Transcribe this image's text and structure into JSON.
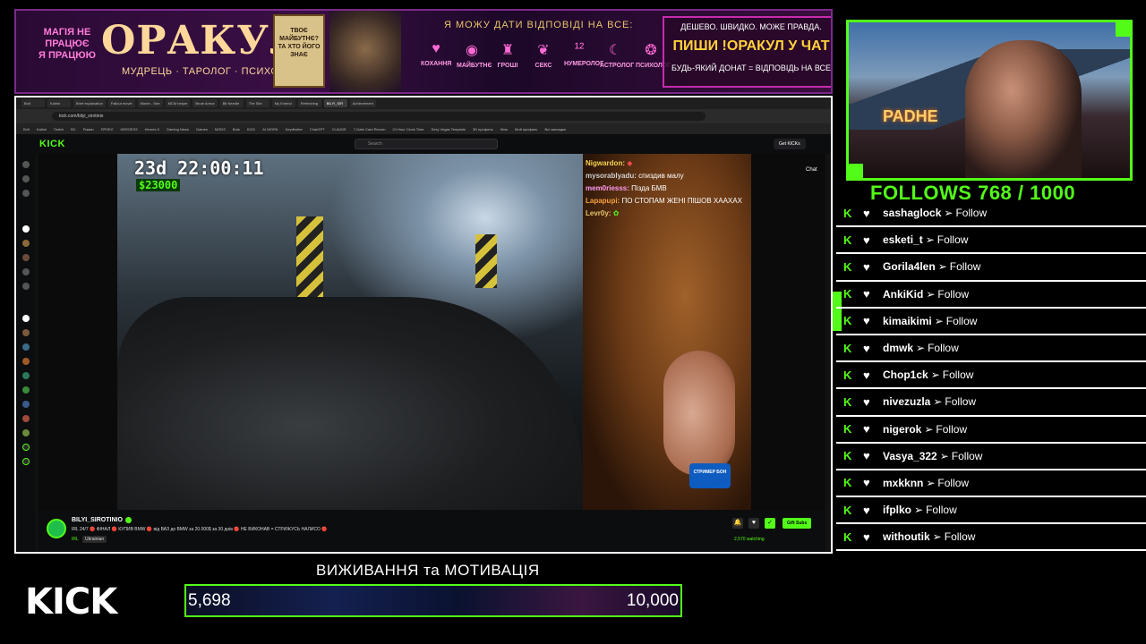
{
  "banner": {
    "magic_line1": "МАГІЯ НЕ",
    "magic_line2": "ПРАЦЮЄ",
    "magic_line3": "Я ПРАЦЮЮ",
    "title": "ОРАКУЛ",
    "subtitle": "МУДРЕЦЬ · ТАРОЛОГ · ПСИХОЛОГ",
    "card_text": "ТВОЄ МАЙБУТНЄ? ТА ХТО ЙОГО ЗНАЄ",
    "can_answer": "Я МОЖУ ДАТИ ВІДПОВІДІ НА ВСЕ:",
    "categories": [
      {
        "label": "КОХАННЯ",
        "icon": "heart-icon"
      },
      {
        "label": "МАЙБУТНЄ",
        "icon": "crystal-ball-icon"
      },
      {
        "label": "ГРОШІ",
        "icon": "money-icon"
      },
      {
        "label": "СЕКС",
        "icon": "peach-icon"
      },
      {
        "label": "НУМЕРОЛОГ",
        "icon": "numbers-icon"
      },
      {
        "label": "АСТРОЛОГ",
        "icon": "moon-icon"
      },
      {
        "label": "ПСИХОЛОГ",
        "icon": "brain-icon"
      }
    ],
    "promo_line1": "ДЕШЕВО. ШВИДКО. МОЖЕ ПРАВДА.",
    "promo_line2": "ПИШИ !ОРАКУЛ У ЧАТ",
    "promo_line3": "БУДЬ-ЯКИЙ ДОНАТ = ВІДПОВІДЬ НА ВСЕ"
  },
  "browser": {
    "tabs": [
      "Bolt",
      "Kalimi",
      "Brief explanation",
      "Fallout movie",
      "Monte - Stre",
      "MCM helper",
      "Brute Armor",
      "Bit Needle",
      "The Site",
      "My Extend",
      "Refreshing",
      "BILYI_SIR",
      "Achievement"
    ],
    "url": "kick.com/bilyi_sirotinio",
    "bookmarks": [
      "Bolt",
      "Kalimi",
      "Twitch",
      "BC",
      "Роман",
      "ПРОЕЛ",
      "HEROES3",
      "Heroes 5",
      "Gaming News",
      "Games",
      "MODS",
      "Bots",
      "KICK",
      "AI WORK",
      "Keydbotter",
      "ChatGPT",
      "CLAUDE",
      "7-Date Card Recom",
      "24 Hour Clock Time",
      "Sexy Vegas Template",
      "3D профиль",
      "films",
      "Мой профиль",
      "Всі закладки"
    ]
  },
  "kick": {
    "logo": "KICK",
    "search_placeholder": "Search",
    "get_kicks": "Get KICKs",
    "chat_button": "Chat"
  },
  "stream": {
    "timer": "23d 22:00:11",
    "money": "$23000",
    "live_badge": "СТРИМЕР БОН",
    "chat": [
      {
        "user": "Nigwardon:",
        "message": "",
        "color": "#f6d354"
      },
      {
        "user": "mysorablyadu:",
        "message": "спиздив малу",
        "color": "#d0d0d0"
      },
      {
        "user": "mem0riesss:",
        "message": "Пізда БМВ",
        "color": "#ff9af0"
      },
      {
        "user": "Lapapupi:",
        "message": "ПО СТОПАМ ЖЕНІ ПІШОВ ХААХАХ",
        "color": "#f6a23c"
      },
      {
        "user": "Levr0y:",
        "message": "",
        "color": "#e8c46a"
      }
    ]
  },
  "channel": {
    "name": "BILYI_SIROTINIO",
    "title": "IRL 24/7 🔴 ФІНАЛ 🔴 КУПИВ BMW 🔴 від ВАЗ до BMW за 20.000$ за 30 днів 🔴 НЕ ВИКОНАВ = СТРИЖУСЬ НАЛИСО 🔴",
    "category": "IRL",
    "language": "Ukrainian",
    "viewers": "2,570 watching",
    "gift_subs": "Gift Subs"
  },
  "goal": {
    "title": "ВИЖИВАННЯ та МОТИВАЦІЯ",
    "current": "5,698",
    "target": "10,000",
    "progress": 0.5698
  },
  "kick_logo": "KICK",
  "webcam": {
    "sign": "PADHE"
  },
  "follows": {
    "title": "FOLLOWS 768 / 1000",
    "arrow": "➢",
    "action": "Follow",
    "items": [
      "sashaglock",
      "esketi_t",
      "Gorila4len",
      "AnkiKid",
      "kimaikimi",
      "dmwk",
      "Chop1ck",
      "nivezuzla",
      "nigerok",
      "Vasya_322",
      "mxkknn",
      "ifplko",
      "withoutik"
    ]
  },
  "colors": {
    "kick_green": "#53fc18",
    "banner_purple": "#3a0f45"
  }
}
